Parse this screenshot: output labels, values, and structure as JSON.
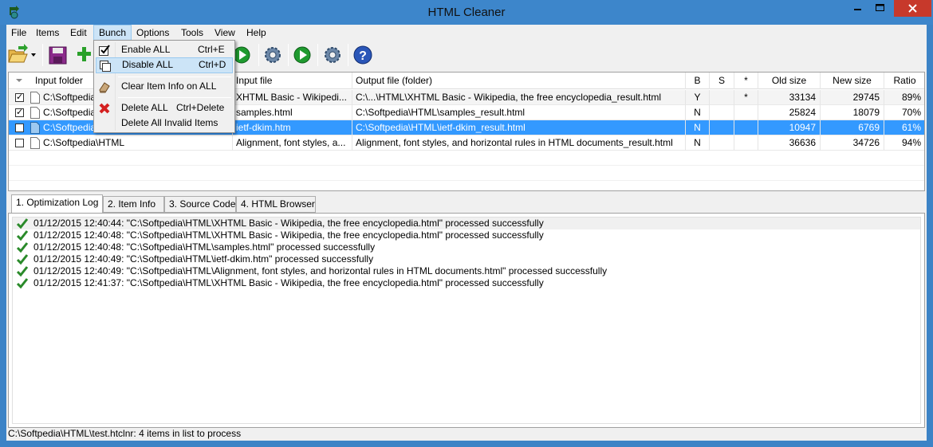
{
  "window": {
    "title": "HTML Cleaner"
  },
  "menu": [
    "File",
    "Items",
    "Edit",
    "Bunch",
    "Options",
    "Tools",
    "View",
    "Help"
  ],
  "bunch_menu": {
    "items": [
      {
        "label": "Enable ALL",
        "shortcut": "Ctrl+E",
        "icon": "checkbox-checked-icon"
      },
      {
        "label": "Disable ALL",
        "shortcut": "Ctrl+D",
        "icon": "checkbox-unchecked-icon"
      },
      {
        "label": "Clear Item Info on ALL",
        "shortcut": "",
        "icon": "eraser-icon"
      },
      {
        "label": "Delete ALL",
        "shortcut": "Ctrl+Delete",
        "icon": "delete-red-x-icon"
      },
      {
        "label": "Delete All Invalid Items",
        "shortcut": "",
        "icon": ""
      }
    ]
  },
  "grid": {
    "columns": [
      "Input folder",
      "Input file",
      "Output file (folder)",
      "B",
      "S",
      "*",
      "Old size",
      "New size",
      "Ratio"
    ],
    "rows": [
      {
        "checked": true,
        "folder": "C:\\Softpedia",
        "file": "XHTML Basic - Wikipedi...",
        "output": "C:\\...\\HTML\\XHTML Basic - Wikipedia, the free encyclopedia_result.html",
        "b": "Y",
        "s": "",
        "star": "*",
        "old": "33134",
        "new": "29745",
        "ratio": "89%"
      },
      {
        "checked": true,
        "folder": "C:\\Softpedia",
        "file": "samples.html",
        "output": "C:\\Softpedia\\HTML\\samples_result.html",
        "b": "N",
        "s": "",
        "star": "",
        "old": "25824",
        "new": "18079",
        "ratio": "70%"
      },
      {
        "checked": false,
        "folder": "C:\\Softpedia",
        "file": "ietf-dkim.htm",
        "output": "C:\\Softpedia\\HTML\\ietf-dkim_result.html",
        "b": "N",
        "s": "",
        "star": "",
        "old": "10947",
        "new": "6769",
        "ratio": "61%"
      },
      {
        "checked": false,
        "folder": "C:\\Softpedia\\HTML",
        "file": "Alignment, font styles, a...",
        "output": "Alignment, font styles, and horizontal rules in HTML documents_result.html",
        "b": "N",
        "s": "",
        "star": "",
        "old": "36636",
        "new": "34726",
        "ratio": "94%"
      }
    ]
  },
  "tabs": [
    "1. Optimization Log",
    "2. Item Info",
    "3. Source Code",
    "4. HTML Browser"
  ],
  "log": [
    "01/12/2015 12:40:44: \"C:\\Softpedia\\HTML\\XHTML Basic - Wikipedia, the free encyclopedia.html\" processed successfully",
    "01/12/2015 12:40:48: \"C:\\Softpedia\\HTML\\XHTML Basic - Wikipedia, the free encyclopedia.html\" processed successfully",
    "01/12/2015 12:40:48: \"C:\\Softpedia\\HTML\\samples.html\" processed successfully",
    "01/12/2015 12:40:49: \"C:\\Softpedia\\HTML\\ietf-dkim.htm\" processed successfully",
    "01/12/2015 12:40:49: \"C:\\Softpedia\\HTML\\Alignment, font styles, and horizontal rules in HTML documents.html\" processed successfully",
    "01/12/2015 12:41:37: \"C:\\Softpedia\\HTML\\XHTML Basic - Wikipedia, the free encyclopedia.html\" processed successfully"
  ],
  "status": "C:\\Softpedia\\HTML\\test.htclnr: 4 items in list to process",
  "colors": {
    "titlebar": "#3d86cb",
    "selection": "#3399ff",
    "close": "#c7392b",
    "menu_highlight": "#cce4f7"
  }
}
